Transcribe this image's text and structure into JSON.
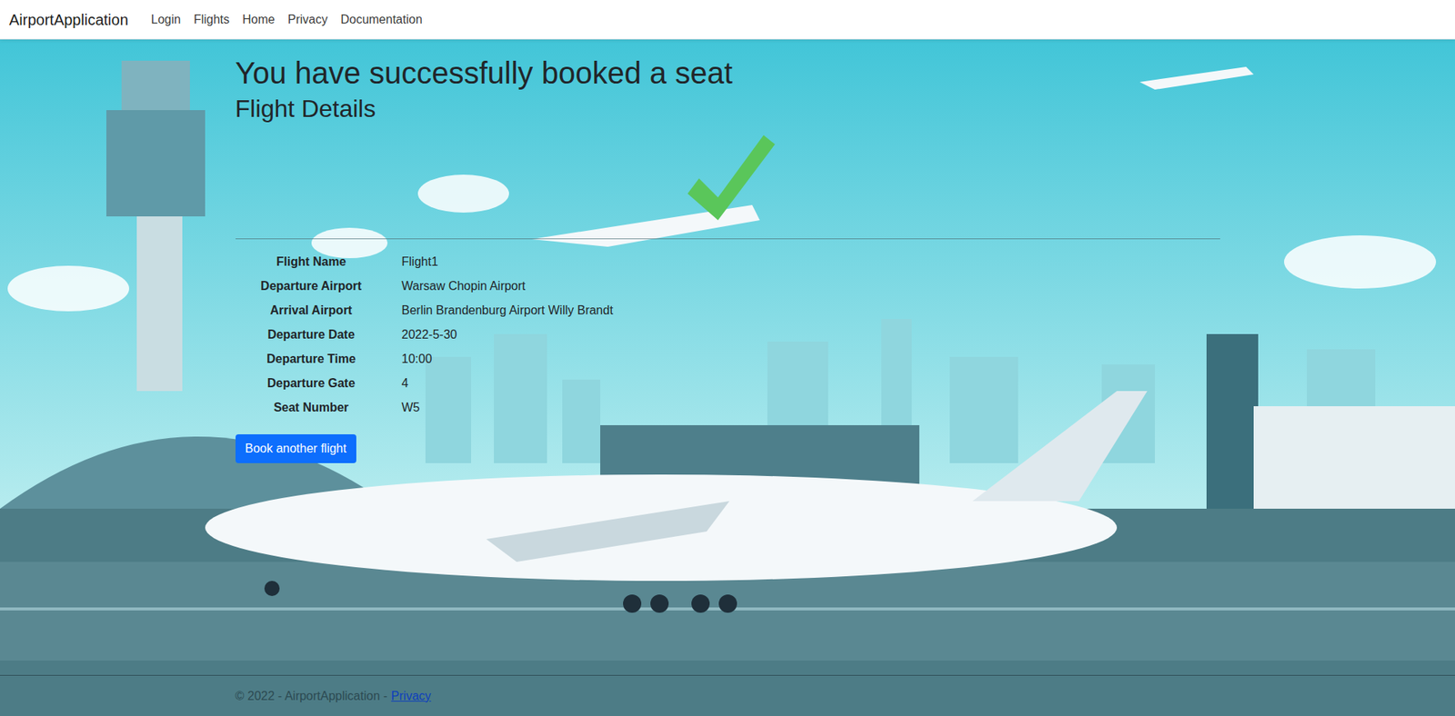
{
  "nav": {
    "brand": "AirportApplication",
    "links": [
      "Login",
      "Flights",
      "Home",
      "Privacy",
      "Documentation"
    ]
  },
  "heading": "You have successfully booked a seat",
  "subheading": "Flight Details",
  "details": [
    {
      "label": "Flight Name",
      "value": "Flight1"
    },
    {
      "label": "Departure Airport",
      "value": "Warsaw Chopin Airport"
    },
    {
      "label": "Arrival Airport",
      "value": "Berlin Brandenburg Airport Willy Brandt"
    },
    {
      "label": "Departure Date",
      "value": "2022-5-30"
    },
    {
      "label": "Departure Time",
      "value": "10:00"
    },
    {
      "label": "Departure Gate",
      "value": "4"
    },
    {
      "label": "Seat Number",
      "value": "W5"
    }
  ],
  "button": "Book another flight",
  "footer": {
    "text": "© 2022 - AirportApplication -",
    "link": "Privacy"
  }
}
